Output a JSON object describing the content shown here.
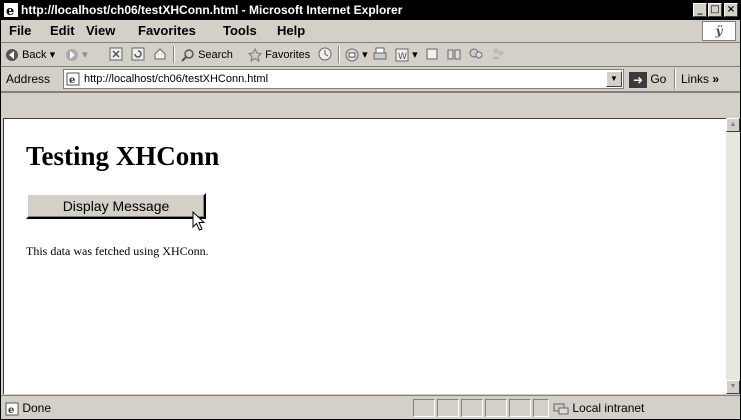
{
  "window": {
    "title": "http://localhost/ch06/testXHConn.html - Microsoft Internet Explorer",
    "controls": {
      "minimize": "_",
      "maximize": "□",
      "close": "×"
    }
  },
  "menu": {
    "items": [
      "File",
      "Edit",
      "View",
      "Favorites",
      "Tools",
      "Help"
    ]
  },
  "toolbar": {
    "back": "Back",
    "search": "Search",
    "favorites": "Favorites",
    "icons": [
      "back-icon",
      "forward-icon",
      "stop-icon",
      "refresh-icon",
      "home-icon",
      "search-icon",
      "favorites-icon",
      "history-icon",
      "mail-icon",
      "print-icon",
      "edit-icon",
      "discuss-icon",
      "research-icon",
      "messenger-icon"
    ]
  },
  "address": {
    "label": "Address",
    "url": "http://localhost/ch06/testXHConn.html",
    "go": "Go",
    "links": "Links",
    "links_chevron": "»"
  },
  "page": {
    "heading": "Testing XHConn",
    "button": "Display Message",
    "message": "This data was fetched using XHConn."
  },
  "status": {
    "text": "Done",
    "zone": "Local intranet"
  },
  "colors": {
    "chrome": "#d4d0c8",
    "titlebar": "#000000",
    "content_bg": "#ffffff"
  }
}
